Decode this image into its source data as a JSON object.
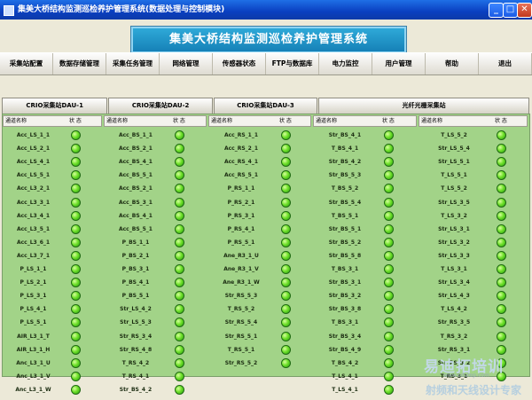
{
  "window": {
    "title": "集美大桥结构监测巡检养护管理系统(数据处理与控制模块)",
    "btn_min": "_",
    "btn_max": "□",
    "btn_close": "✕"
  },
  "banner": {
    "title": "集美大桥结构监测巡检养护管理系统"
  },
  "menu": [
    "采集站配置",
    "数据存储管理",
    "采集任务管理",
    "网络管理",
    "传感器状态",
    "FTP与数据库",
    "电力监控",
    "用户管理",
    "帮助",
    "退出"
  ],
  "tabs": [
    "CRIO采集站DAU-1",
    "CRIO采集站DAU-2",
    "CRIO采集站DAU-3",
    "光纤光栅采集站"
  ],
  "table": {
    "header_name": "通道名称",
    "header_status": "状 态",
    "status_color": "#6fe02a",
    "columns": [
      [
        "Acc_LS_1_1",
        "Acc_LS_2_1",
        "Acc_LS_4_1",
        "Acc_LS_5_1",
        "Acc_L3_2_1",
        "Acc_L3_3_1",
        "Acc_L3_4_1",
        "Acc_L3_5_1",
        "Acc_L3_6_1",
        "Acc_L3_7_1",
        "P_LS_1_1",
        "P_LS_2_1",
        "P_LS_3_1",
        "P_LS_4_1",
        "P_LS_5_1",
        "AIR_L3_1_T",
        "AIR_L3_1_H",
        "Anc_L3_1_U",
        "Anc_L3_1_V",
        "Anc_L3_1_W"
      ],
      [
        "Acc_BS_1_1",
        "Acc_BS_2_1",
        "Acc_BS_4_1",
        "Acc_BS_5_1",
        "Acc_BS_2_1",
        "Acc_BS_3_1",
        "Acc_BS_4_1",
        "Acc_BS_5_1",
        "P_BS_1_1",
        "P_BS_2_1",
        "P_BS_3_1",
        "P_BS_4_1",
        "P_BS_5_1",
        "Str_LS_4_2",
        "Str_LS_5_3",
        "Str_RS_3_4",
        "Str_RS_4_8",
        "T_RS_4_2",
        "T_RS_4_1",
        "Str_BS_4_2"
      ],
      [
        "Acc_RS_1_1",
        "Acc_RS_2_1",
        "Acc_RS_4_1",
        "Acc_RS_5_1",
        "P_RS_1_1",
        "P_RS_2_1",
        "P_RS_3_1",
        "P_RS_4_1",
        "P_RS_5_1",
        "Ane_R3_1_U",
        "Ane_R3_1_V",
        "Ane_R3_1_W",
        "Str_RS_5_3",
        "T_RS_5_2",
        "Str_RS_5_4",
        "Str_RS_5_1",
        "T_RS_5_1",
        "Str_RS_5_2"
      ],
      [
        "Str_BS_4_1",
        "T_BS_4_1",
        "Str_BS_4_2",
        "Str_BS_5_3",
        "T_BS_5_2",
        "Str_BS_5_4",
        "T_BS_5_1",
        "Str_BS_5_1",
        "Str_BS_5_2",
        "Str_BS_5_8",
        "T_BS_3_1",
        "Str_BS_3_1",
        "Str_BS_3_2",
        "Str_BS_3_8",
        "T_BS_3_1",
        "Str_BS_3_4",
        "Str_BS_4_9",
        "T_BS_4_2",
        "T_LS_4_1",
        "T_LS_4_1"
      ],
      [
        "T_LS_5_2",
        "Str_LS_5_4",
        "Str_LS_5_1",
        "T_LS_5_1",
        "T_LS_5_2",
        "Str_LS_3_5",
        "T_LS_3_2",
        "Str_LS_3_1",
        "Str_LS_3_2",
        "Str_LS_3_3",
        "T_LS_3_1",
        "Str_LS_3_4",
        "Str_LS_4_3",
        "T_LS_4_2",
        "Str_RS_3_5",
        "T_RS_3_2",
        "Str_RS_3_1",
        "Str_RS_3_2",
        "T_RS_3_1"
      ]
    ]
  },
  "watermark": {
    "brand": "易迪拓培训",
    "tagline": "射频和天线设计专家",
    "url": "www.edatop.com"
  }
}
